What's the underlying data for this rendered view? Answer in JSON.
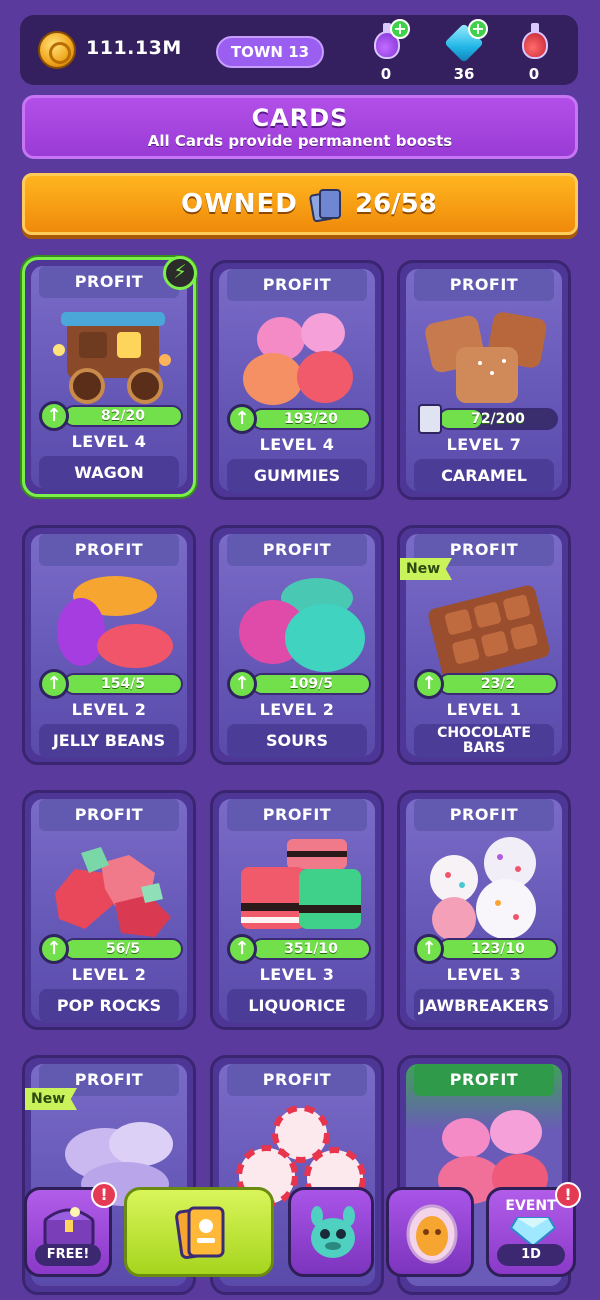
{
  "topbar": {
    "coins": "111.13M",
    "town": "TOWN 13",
    "resources": [
      {
        "icon": "purple-potion-icon",
        "value": "0",
        "has_plus": true
      },
      {
        "icon": "blue-gem-icon",
        "value": "36",
        "has_plus": true
      },
      {
        "icon": "red-potion-icon",
        "value": "0",
        "has_plus": false
      }
    ]
  },
  "header": {
    "title": "CARDS",
    "subtitle": "All Cards provide permanent boosts"
  },
  "owned": {
    "label": "OWNED",
    "count": "26/58"
  },
  "cards": [
    {
      "tab": "PROFIT",
      "progress": "82/20",
      "level": "LEVEL 4",
      "name": "WAGON",
      "selected": true,
      "boost": true,
      "upgradeable": true
    },
    {
      "tab": "PROFIT",
      "progress": "193/20",
      "level": "LEVEL 4",
      "name": "GUMMIES",
      "upgradeable": true
    },
    {
      "tab": "PROFIT",
      "progress": "72/200",
      "level": "LEVEL 7",
      "name": "CARAMEL",
      "upgradeable": false,
      "fill": 0.36
    },
    {
      "tab": "PROFIT",
      "progress": "154/5",
      "level": "LEVEL 2",
      "name": "JELLY BEANS",
      "upgradeable": true
    },
    {
      "tab": "PROFIT",
      "progress": "109/5",
      "level": "LEVEL 2",
      "name": "SOURS",
      "upgradeable": true
    },
    {
      "tab": "PROFIT",
      "progress": "23/2",
      "level": "LEVEL 1",
      "name": "CHOCOLATE BARS",
      "new": "New",
      "upgradeable": true
    },
    {
      "tab": "PROFIT",
      "progress": "56/5",
      "level": "LEVEL 2",
      "name": "POP ROCKS",
      "upgradeable": true
    },
    {
      "tab": "PROFIT",
      "progress": "351/10",
      "level": "LEVEL 3",
      "name": "LIQUORICE",
      "upgradeable": true
    },
    {
      "tab": "PROFIT",
      "progress": "123/10",
      "level": "LEVEL 3",
      "name": "JAWBREAKERS",
      "upgradeable": true
    },
    {
      "tab": "PROFIT",
      "new": "New"
    },
    {
      "tab": "PROFIT"
    },
    {
      "tab": "PROFIT",
      "highlight": true
    }
  ],
  "nav": {
    "chest_label": "FREE!",
    "event_label": "EVENT",
    "event_timer": "1D",
    "alert": "!"
  },
  "colors": {
    "background": "#5a3a9c",
    "owned_bar": "#f8a215",
    "progress_green": "#72e04a",
    "header_purple": "#a645de"
  }
}
